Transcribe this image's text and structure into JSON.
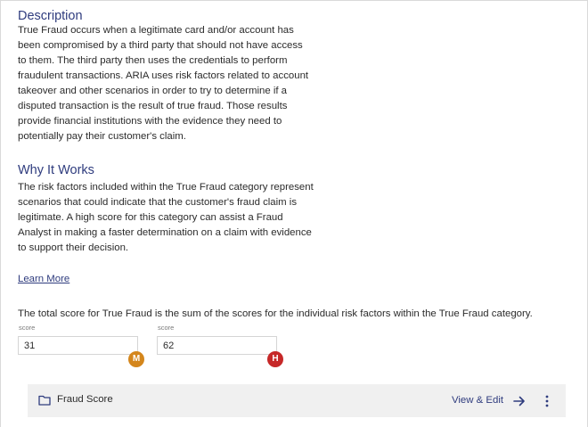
{
  "description": {
    "heading": "Description",
    "lines": [
      "True Fraud occurs when a legitimate card and/or account has",
      "been compromised by a third party that should not have access",
      "to them. The third party then uses the credentials to perform",
      "fraudulent transactions. ARIA uses risk factors related to account",
      "takeover and other scenarios in order to try to determine if a",
      "disputed transaction is the result of true fraud. Those results",
      "provide financial institutions with the evidence they need to",
      "potentially pay their customer's claim."
    ]
  },
  "why": {
    "heading": "Why It Works",
    "lines": [
      "The risk factors included within the True Fraud category represent",
      "scenarios that could indicate that the customer's fraud claim is",
      "legitimate. A high score for this category can assist a Fraud",
      "Analyst in making a faster determination on a claim with evidence",
      "to support their decision."
    ]
  },
  "learn_more": "Learn More",
  "total_text": "The total score for True Fraud is the sum of the scores for the individual risk factors within the True Fraud category.",
  "scores": [
    {
      "label": "score",
      "value": "31",
      "badge": "M",
      "badge_color": "#d4861c"
    },
    {
      "label": "score",
      "value": "62",
      "badge": "H",
      "badge_color": "#c62828"
    }
  ],
  "card": {
    "icon": "folder-icon",
    "title": "Fraud Score",
    "action_label": "View & Edit",
    "action_icon": "arrow-right-icon",
    "menu_icon": "more-vert-icon"
  },
  "colors": {
    "heading": "#2f3c7e",
    "link": "#2f3c7e",
    "card_background": "#f0f0f0"
  }
}
